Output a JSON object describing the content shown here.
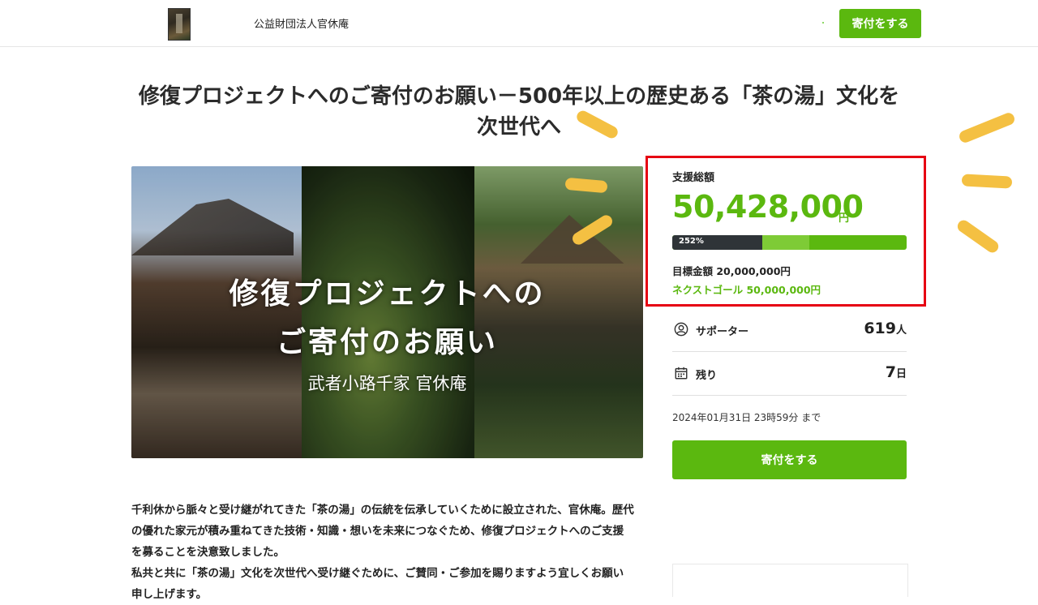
{
  "header": {
    "org_name": "公益財団法人官休庵",
    "donate_label": "寄付をする"
  },
  "page": {
    "title": "修復プロジェクトへのご寄付のお願い－500年以上の歴史ある「茶の湯」文化を次世代へ"
  },
  "hero": {
    "line1": "修復プロジェクトへの",
    "line2": "ご寄付のお願い",
    "line3": "武者小路千家 官休庵"
  },
  "funding": {
    "label": "支援総額",
    "amount": "50,428,000",
    "currency": "円",
    "progress_text": "252%",
    "progress_percent": 252,
    "goal": "目標金額 20,000,000円",
    "next_goal": "ネクストゴール 50,000,000円"
  },
  "stats": {
    "supporters_label": "サポーター",
    "supporters_value": "619",
    "supporters_unit": "人",
    "remaining_label": "残り",
    "remaining_value": "7",
    "remaining_unit": "日"
  },
  "deadline": "2024年01月31日 23時59分 まで",
  "main_button": "寄付をする",
  "description": {
    "p1": "千利休から脈々と受け継がれてきた「茶の湯」の伝統を伝承していくために設立された、官休庵。歴代の優れた家元が積み重ねてきた技術・知識・想いを未来につなぐため、修復プロジェクトへのご支援を募ることを決意致しました。",
    "p2": "私共と共に「茶の湯」文化を次世代へ受け継ぐために、ご賛同・ご参加を賜りますよう宜しくお願い申し上げます。"
  },
  "colors": {
    "accent": "#5bb80f",
    "highlight_box": "#e60012",
    "annotation": "#f4c042"
  },
  "icons": {
    "supporters": "user-circle-icon",
    "remaining": "calendar-icon"
  }
}
